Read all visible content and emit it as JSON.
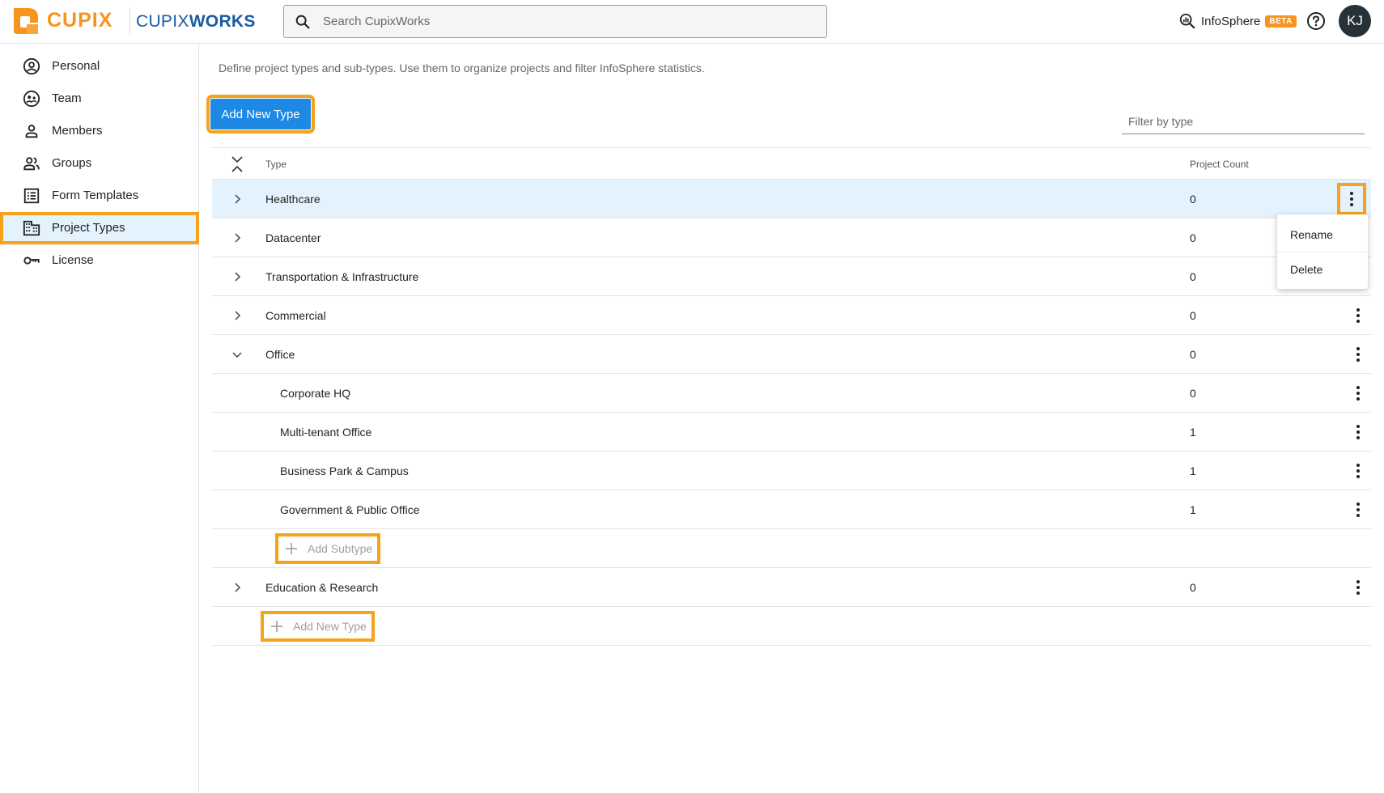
{
  "brand": {
    "logo_text": "CUPIX",
    "product_light": "CUPIX",
    "product_bold": "WORKS",
    "accent": "#f7941d",
    "product_color": "#1a5aa6"
  },
  "search": {
    "placeholder": "Search CupixWorks"
  },
  "header": {
    "infosphere_label": "InfoSphere",
    "beta_badge": "BETA",
    "avatar_initials": "KJ"
  },
  "sidebar": {
    "items": [
      {
        "label": "Personal",
        "icon": "account-circle-icon"
      },
      {
        "label": "Team",
        "icon": "team-icon"
      },
      {
        "label": "Members",
        "icon": "person-icon"
      },
      {
        "label": "Groups",
        "icon": "groups-icon"
      },
      {
        "label": "Form Templates",
        "icon": "list-form-icon"
      },
      {
        "label": "Project Types",
        "icon": "building-icon",
        "active": true
      },
      {
        "label": "License",
        "icon": "key-icon"
      }
    ]
  },
  "main": {
    "description": "Define project types and sub-types. Use them to organize projects and filter InfoSphere statistics.",
    "add_button_label": "Add New Type",
    "filter_placeholder": "Filter by type",
    "columns": {
      "type": "Type",
      "count": "Project Count"
    },
    "rows": [
      {
        "name": "Healthcare",
        "count": "0"
      },
      {
        "name": "Datacenter",
        "count": "0"
      },
      {
        "name": "Transportation & Infrastructure",
        "count": "0"
      },
      {
        "name": "Commercial",
        "count": "0"
      },
      {
        "name": "Office",
        "count": "0"
      },
      {
        "name": "Corporate HQ",
        "count": "0"
      },
      {
        "name": "Multi-tenant Office",
        "count": "1"
      },
      {
        "name": "Business Park & Campus",
        "count": "1"
      },
      {
        "name": "Government & Public Office",
        "count": "1"
      },
      {
        "name": "Education & Research",
        "count": "0"
      }
    ],
    "add_subtype_label": "Add Subtype",
    "add_type_label": "Add New Type"
  },
  "menu": {
    "rename": "Rename",
    "delete": "Delete"
  },
  "colors": {
    "primary": "#1e88e5",
    "highlight": "#f7a21b",
    "selected_row": "#e3f2fd"
  }
}
